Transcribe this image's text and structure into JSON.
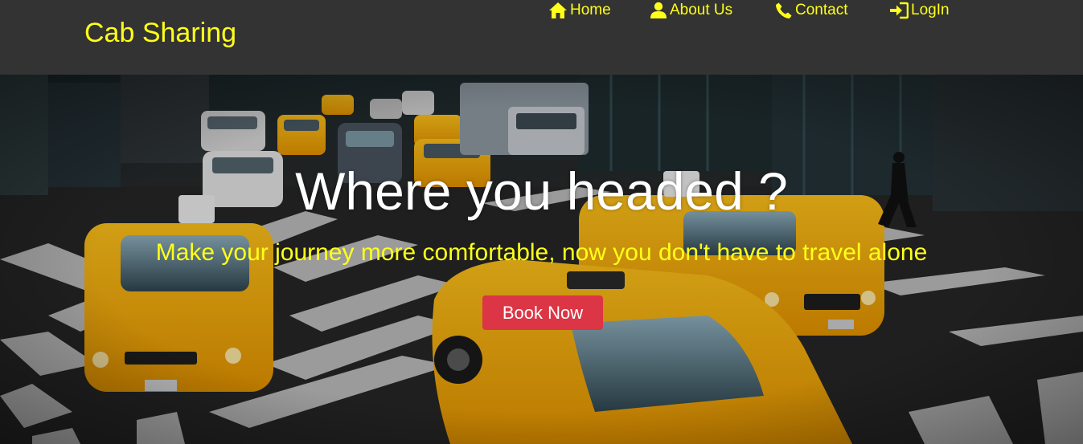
{
  "brand": {
    "label": "Cab Sharing"
  },
  "nav": {
    "items": [
      {
        "label": "Home",
        "icon": "home-icon"
      },
      {
        "label": "About Us",
        "icon": "user-icon"
      },
      {
        "label": "Contact",
        "icon": "phone-icon"
      },
      {
        "label": "LogIn",
        "icon": "login-icon"
      }
    ]
  },
  "hero": {
    "title": "Where you headed ?",
    "subtitle": "Make your journey more comfortable, now you don't have to travel alone",
    "cta_label": "Book Now",
    "background": "city-street-yellow-taxis-photo"
  },
  "colors": {
    "navbar_bg": "#333333",
    "accent_yellow": "#ffff1a",
    "cta_red": "#dc3545",
    "taxi_yellow": "#f5a800"
  }
}
